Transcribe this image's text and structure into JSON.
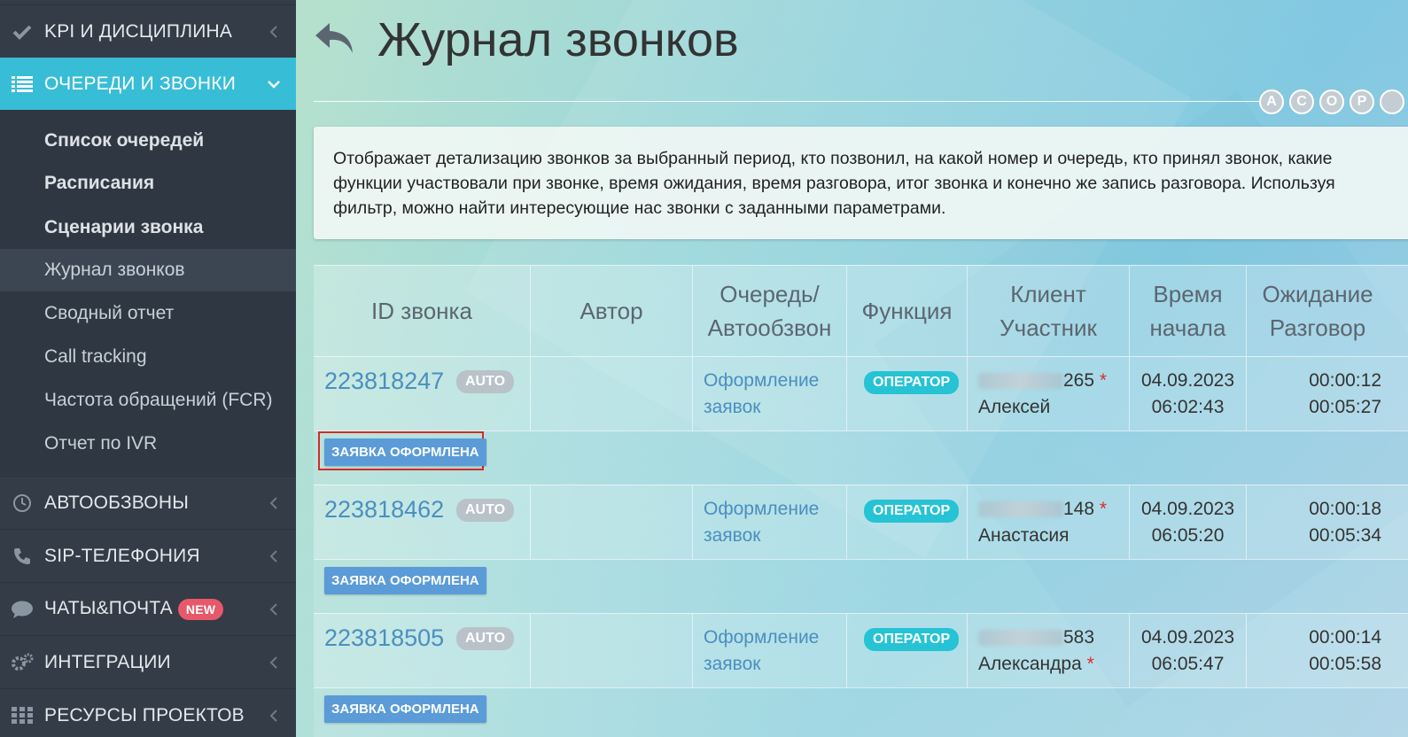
{
  "sidebar": {
    "top_items": [
      {
        "label": "KPI И ДИСЦИПЛИНА",
        "icon": "check-icon"
      },
      {
        "label": "ОЧЕРЕДИ И ЗВОНКИ",
        "icon": "list-icon"
      }
    ],
    "sub_items": [
      {
        "label": "Список очередей"
      },
      {
        "label": "Расписания"
      },
      {
        "label": "Сценарии звонка"
      },
      {
        "label": "Журнал звонков"
      },
      {
        "label": "Сводный отчет"
      },
      {
        "label": "Call tracking"
      },
      {
        "label": "Частота обращений (FCR)"
      },
      {
        "label": "Отчет по IVR"
      }
    ],
    "bottom_items": [
      {
        "label": "АВТООБЗВОНЫ",
        "icon": "clock-icon"
      },
      {
        "label": "SIP-ТЕЛЕФОНИЯ",
        "icon": "phone-icon"
      },
      {
        "label": "ЧАТЫ&ПОЧТА",
        "icon": "chat-icon",
        "badge": "NEW"
      },
      {
        "label": "ИНТЕГРАЦИИ",
        "icon": "gears-icon"
      },
      {
        "label": "РЕСУРСЫ ПРОЕКТОВ",
        "icon": "grid-icon"
      }
    ]
  },
  "page": {
    "title": "Журнал звонков",
    "circle_buttons": [
      "A",
      "C",
      "O",
      "P"
    ],
    "description": "Отображает детализацию звонков за выбранный период, кто позвонил, на какой номер и очередь, кто принял звонок, какие функции участвовали при звонке, время ожидания, время разговора, итог звонка и конечно же запись разговора. Используя фильтр, можно найти интересующие нас звонки с заданными параметрами."
  },
  "table": {
    "headers": {
      "id": "ID звонка",
      "author": "Автор",
      "queue": "Очередь/ Автообзвон",
      "function": "Функция",
      "client": "Клиент Участник",
      "start": "Время начала",
      "wait": "Ожидание Разговор"
    },
    "rows": [
      {
        "id": "223818247",
        "auto": "AUTO",
        "queue": "Оформление заявок",
        "function": "ОПЕРАТОР",
        "phone_suffix": "265",
        "client_name": "Алексей",
        "date": "04.09.2023",
        "time": "06:02:43",
        "wait": "00:00:12",
        "talk": "00:05:27",
        "status": "ЗАЯВКА ОФОРМЛЕНА"
      },
      {
        "id": "223818462",
        "auto": "AUTO",
        "queue": "Оформление заявок",
        "function": "ОПЕРАТОР",
        "phone_suffix": "148",
        "client_name": "Анастасия",
        "date": "04.09.2023",
        "time": "06:05:20",
        "wait": "00:00:18",
        "talk": "00:05:34",
        "status": "ЗАЯВКА ОФОРМЛЕНА"
      },
      {
        "id": "223818505",
        "auto": "AUTO",
        "queue": "Оформление заявок",
        "function": "ОПЕРАТОР",
        "phone_suffix": "583",
        "client_name": "Александра",
        "date": "04.09.2023",
        "time": "06:05:47",
        "wait": "00:00:14",
        "talk": "00:05:58",
        "status": "ЗАЯВКА ОФОРМЛЕНА"
      }
    ]
  }
}
